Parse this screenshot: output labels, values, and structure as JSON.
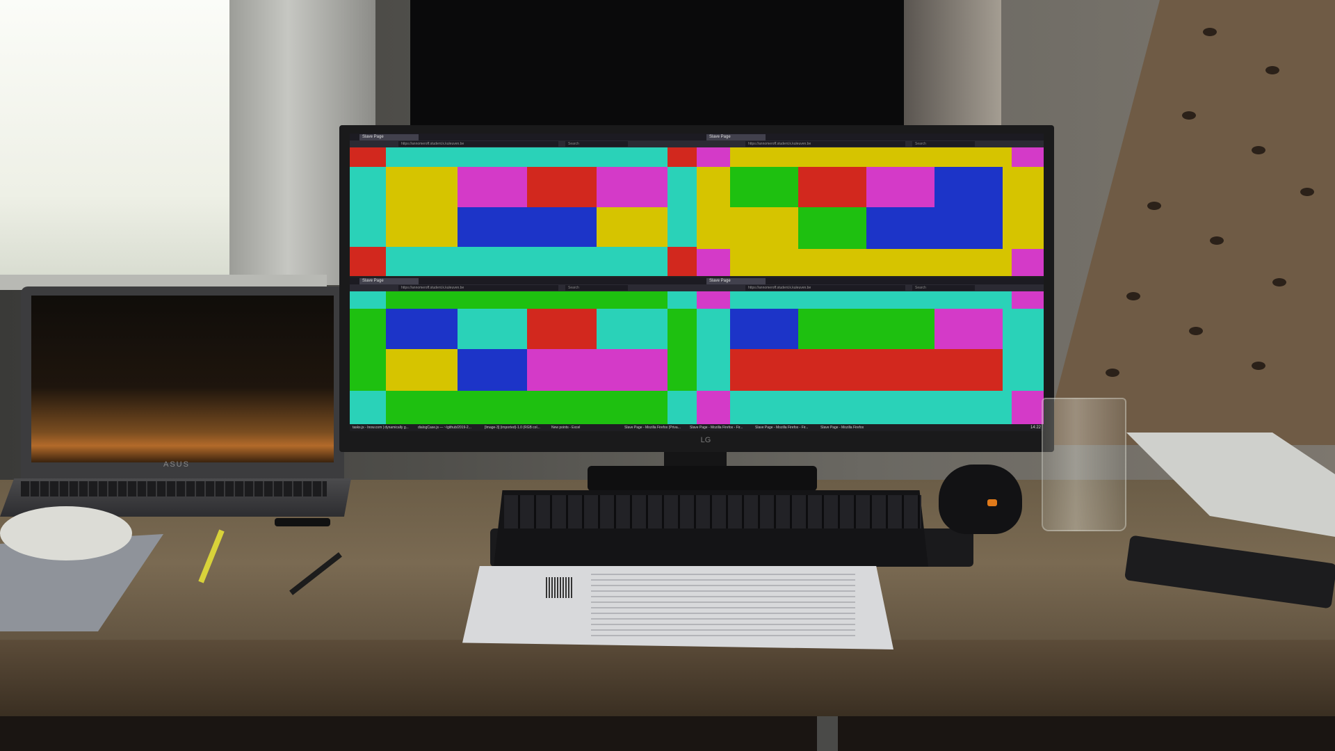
{
  "windows": [
    {
      "tab": "Slave Page",
      "url": "https://annomeroff.student.k.kuleuven.be",
      "search": "Search"
    },
    {
      "tab": "Slave Page",
      "url": "https://annomeroff.student.k.kuleuven.be",
      "search": "Search"
    },
    {
      "tab": "Slave Page",
      "url": "https://annomeroff.student.k.kuleuven.be",
      "search": "Search"
    },
    {
      "tab": "Slave Page",
      "url": "https://annomeroff.student.k.kuleuven.be",
      "search": "Search"
    }
  ],
  "taskbar": {
    "items": [
      "tasks.js - Inow.com | dynamically g...",
      "dialogCase.js — ~/github/2019-2...",
      "[Image-3] (imported)-1.0 (RGB col...",
      "New points - Excel",
      "Slave Page - Mozilla Firefox (Priva...",
      "Slave Page - Mozilla Firefox - Fir...",
      "Slave Page - Mozilla Firefox - Fir...",
      "Slave Page - Mozilla Firefox"
    ],
    "clock": "14:22"
  },
  "brands": {
    "laptop": "ASUS",
    "monitor": "LG"
  },
  "colors": {
    "cyan": "#2ad2b8",
    "yellow": "#d6c400",
    "magenta": "#d43ac8",
    "red": "#d2281e",
    "blue": "#1c34c8",
    "green": "#1ec010"
  }
}
